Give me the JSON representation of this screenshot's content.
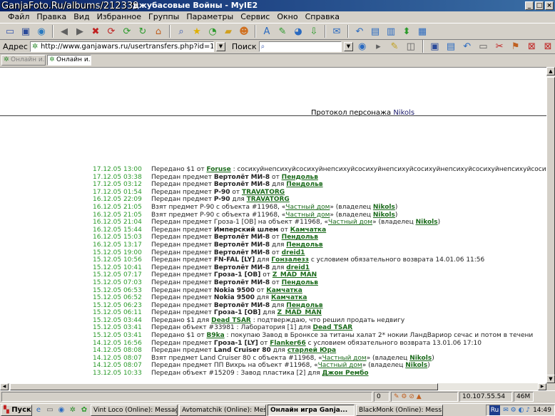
{
  "watermark": "GanjaFoto.Ru/albums/212339",
  "window_title": "джубасовые Войны - MyIE2",
  "title_buttons": [
    "_",
    "□",
    "×"
  ],
  "menu": [
    "Файл",
    "Правка",
    "Вид",
    "Избранное",
    "Группы",
    "Параметры",
    "Сервис",
    "Окно",
    "Справка"
  ],
  "toolbar_icons": [
    "new-icon",
    "save-icon",
    "globe-icon",
    "back-icon",
    "forward-icon",
    "stop-icon",
    "refresh-icon",
    "refresh-all-icon",
    "home-icon",
    "search-icon",
    "favorites-icon",
    "history-icon",
    "folder-icon",
    "user-icon",
    "font-icon",
    "highlight-icon",
    "browser-icon",
    "download-icon",
    "mail-icon",
    "undo-icon",
    "layout-icon",
    "window-icon",
    "arrange-icon",
    "grid-icon"
  ],
  "address": {
    "label": "Адрес",
    "url": "http://www.ganjawars.ru/usertransfers.php?id=170013",
    "search_label": "Поиск"
  },
  "tabs": [
    "Онлайн и...",
    "Онлайн и..."
  ],
  "protocol": {
    "prefix": "Протокол персонажа",
    "name": "Nikols"
  },
  "log": [
    {
      "ts": "17.12.05 13:00",
      "parts": [
        [
          "t",
          "Передано $1 от "
        ],
        [
          "l",
          "Foruse"
        ],
        [
          "t",
          " : сосихуйнепсихуйсосихуйнепсихуйсосихуйнепсихуйсосихуйнепсихуйсосихуйнепсихуйсосихуйнепсихуйсосихуй"
        ]
      ]
    },
    {
      "ts": "17.12.05 03:38",
      "parts": [
        [
          "t",
          "Передан предмет "
        ],
        [
          "b",
          "Вертолёт МИ-8"
        ],
        [
          "t",
          " от "
        ],
        [
          "l",
          "Пендольв"
        ]
      ]
    },
    {
      "ts": "17.12.05 03:12",
      "parts": [
        [
          "t",
          "Передан предмет "
        ],
        [
          "b",
          "Вертолёт МИ-8"
        ],
        [
          "t",
          " для "
        ],
        [
          "l",
          "Пендольв"
        ]
      ]
    },
    {
      "ts": "17.12.05 01:54",
      "parts": [
        [
          "t",
          "Передан предмет "
        ],
        [
          "b",
          "P-90"
        ],
        [
          "t",
          " от "
        ],
        [
          "l",
          "TRAVATORG"
        ]
      ]
    },
    {
      "ts": "16.12.05 22:09",
      "parts": [
        [
          "t",
          "Передан предмет "
        ],
        [
          "b",
          "P-90"
        ],
        [
          "t",
          " для "
        ],
        [
          "l",
          "TRAVATORG"
        ]
      ]
    },
    {
      "ts": "16.12.05 21:05",
      "parts": [
        [
          "t",
          "Взят предмет P-90 с объекта #11968, «"
        ],
        [
          "n",
          "Частный дом"
        ],
        [
          "t",
          "» (владелец "
        ],
        [
          "l",
          "Nikols"
        ],
        [
          "t",
          ")"
        ]
      ]
    },
    {
      "ts": "16.12.05 21:05",
      "parts": [
        [
          "t",
          "Взят предмет P-90 с объекта #11968, «"
        ],
        [
          "n",
          "Частный дом"
        ],
        [
          "t",
          "» (владелец "
        ],
        [
          "l",
          "Nikols"
        ],
        [
          "t",
          ")"
        ]
      ]
    },
    {
      "ts": "16.12.05 21:04",
      "parts": [
        [
          "t",
          "Передан предмет Гроза-1 [OB] на объект #11968, «"
        ],
        [
          "n",
          "Частный дом"
        ],
        [
          "t",
          "» (владелец "
        ],
        [
          "l",
          "Nikols"
        ],
        [
          "t",
          ")"
        ]
      ]
    },
    {
      "ts": "16.12.05 15:44",
      "parts": [
        [
          "t",
          "Передан предмет "
        ],
        [
          "b",
          "Имперский шлем"
        ],
        [
          "t",
          " от "
        ],
        [
          "l",
          "Камчатка"
        ]
      ]
    },
    {
      "ts": "16.12.05 15:03",
      "parts": [
        [
          "t",
          "Передан предмет "
        ],
        [
          "b",
          "Вертолёт МИ-8"
        ],
        [
          "t",
          " от "
        ],
        [
          "l",
          "Пендольв"
        ]
      ]
    },
    {
      "ts": "16.12.05 13:17",
      "parts": [
        [
          "t",
          "Передан предмет "
        ],
        [
          "b",
          "Вертолёт МИ-8"
        ],
        [
          "t",
          " для "
        ],
        [
          "l",
          "Пендольв"
        ]
      ]
    },
    {
      "ts": "15.12.05 19:00",
      "parts": [
        [
          "t",
          "Передан предмет "
        ],
        [
          "b",
          "Вертолёт МИ-8"
        ],
        [
          "t",
          " от "
        ],
        [
          "l",
          "dreid1"
        ]
      ]
    },
    {
      "ts": "15.12.05 10:56",
      "parts": [
        [
          "t",
          "Передан предмет "
        ],
        [
          "b",
          "FN-FAL [LY]"
        ],
        [
          "t",
          " для "
        ],
        [
          "l",
          "Гонзалезз"
        ],
        [
          "t",
          " с условием обязательного возврата 14.01.06 11:56"
        ]
      ]
    },
    {
      "ts": "15.12.05 10:41",
      "parts": [
        [
          "t",
          "Передан предмет "
        ],
        [
          "b",
          "Вертолёт МИ-8"
        ],
        [
          "t",
          " для "
        ],
        [
          "l",
          "dreid1"
        ]
      ]
    },
    {
      "ts": "15.12.05 07:17",
      "parts": [
        [
          "t",
          "Передан предмет "
        ],
        [
          "b",
          "Гроза-1 [OB]"
        ],
        [
          "t",
          " от "
        ],
        [
          "l",
          "Z_MAD_MAN"
        ]
      ]
    },
    {
      "ts": "15.12.05 07:03",
      "parts": [
        [
          "t",
          "Передан предмет "
        ],
        [
          "b",
          "Вертолёт МИ-8"
        ],
        [
          "t",
          " от "
        ],
        [
          "l",
          "Пендольв"
        ]
      ]
    },
    {
      "ts": "15.12.05 06:53",
      "parts": [
        [
          "t",
          "Передан предмет "
        ],
        [
          "b",
          "Nokia 9500"
        ],
        [
          "t",
          " от "
        ],
        [
          "l",
          "Камчатка"
        ]
      ]
    },
    {
      "ts": "15.12.05 06:52",
      "parts": [
        [
          "t",
          "Передан предмет "
        ],
        [
          "b",
          "Nokia 9500"
        ],
        [
          "t",
          " для "
        ],
        [
          "l",
          "Камчатка"
        ]
      ]
    },
    {
      "ts": "15.12.05 06:23",
      "parts": [
        [
          "t",
          "Передан предмет "
        ],
        [
          "b",
          "Вертолёт МИ-8"
        ],
        [
          "t",
          " для "
        ],
        [
          "l",
          "Пендольв"
        ]
      ]
    },
    {
      "ts": "15.12.05 06:11",
      "parts": [
        [
          "t",
          "Передан предмет "
        ],
        [
          "b",
          "Гроза-1 [OB]"
        ],
        [
          "t",
          " для "
        ],
        [
          "l",
          "Z_MAD_MAN"
        ]
      ]
    },
    {
      "ts": "15.12.05 03:44",
      "parts": [
        [
          "t",
          "Передано $1 для "
        ],
        [
          "l",
          "Dead TSAR"
        ],
        [
          "t",
          " : подтверждаю, что решил продать недвигу"
        ]
      ]
    },
    {
      "ts": "15.12.05 03:41",
      "parts": [
        [
          "t",
          "Передан объект #33981 : Лаборатория [1] для "
        ],
        [
          "l",
          "Dead TSAR"
        ]
      ]
    },
    {
      "ts": "15.12.05 03:41",
      "parts": [
        [
          "t",
          "Передано $1 от "
        ],
        [
          "l",
          "B9ka"
        ],
        [
          "t",
          " : покупаю Завод в Бронксе за титаны халат 2* нокии ЛандВариор сечас и потом в течени"
        ]
      ]
    },
    {
      "ts": "14.12.05 16:56",
      "parts": [
        [
          "t",
          "Передан предмет "
        ],
        [
          "b",
          "Гроза-1 [LY]"
        ],
        [
          "t",
          " от "
        ],
        [
          "l",
          "Flanker66"
        ],
        [
          "t",
          " с условием обязательного возврата 13.01.06 17:10"
        ]
      ]
    },
    {
      "ts": "14.12.05 08:08",
      "parts": [
        [
          "t",
          "Передан предмет "
        ],
        [
          "b",
          "Land Cruiser 80"
        ],
        [
          "t",
          " для "
        ],
        [
          "l",
          "старлей Юра"
        ]
      ]
    },
    {
      "ts": "14.12.05 08:07",
      "parts": [
        [
          "t",
          "Взят предмет Land Cruiser 80 с объекта #11968, «"
        ],
        [
          "n",
          "Частный дом"
        ],
        [
          "t",
          "» (владелец "
        ],
        [
          "l",
          "Nikols"
        ],
        [
          "t",
          ")"
        ]
      ]
    },
    {
      "ts": "14.12.05 08:07",
      "parts": [
        [
          "t",
          "Передан предмет ПП Вихрь на объект #11968, «"
        ],
        [
          "n",
          "Частный дом"
        ],
        [
          "t",
          "» (владелец "
        ],
        [
          "l",
          "Nikols"
        ],
        [
          "t",
          ")"
        ]
      ]
    },
    {
      "ts": "13.12.05 10:33",
      "parts": [
        [
          "t",
          "Передан объект #15209 : Завод пластика [2] для "
        ],
        [
          "l",
          "Джон Рембо"
        ]
      ]
    }
  ],
  "status": {
    "count": "0",
    "ip": "10.107.55.54",
    "mem": "46M"
  },
  "taskbar": {
    "start": "Пуск",
    "tasks": [
      "Vint Loco (Online): Messag...",
      "Avtomatchik (Online): Mes...",
      "Онлайн игра Ganja...",
      "BlackMonk (Online): Mess..."
    ],
    "lang": "Ru",
    "time": "14:49"
  }
}
